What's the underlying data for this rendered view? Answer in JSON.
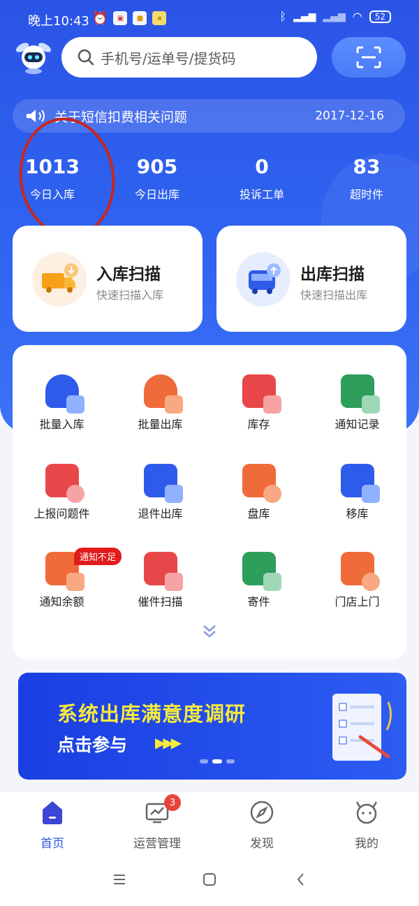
{
  "status": {
    "time": "晚上10:43",
    "battery": "52"
  },
  "search": {
    "placeholder": "手机号/运单号/提货码"
  },
  "notice": {
    "text": "关于短信扣费相关问题",
    "date": "2017-12-16"
  },
  "stats": [
    {
      "value": "1013",
      "label": "今日入库"
    },
    {
      "value": "905",
      "label": "今日出库"
    },
    {
      "value": "0",
      "label": "投诉工单"
    },
    {
      "value": "83",
      "label": "超时件"
    }
  ],
  "scan_cards": [
    {
      "title": "入库扫描",
      "subtitle": "快速扫描入库"
    },
    {
      "title": "出库扫描",
      "subtitle": "快速扫描出库"
    }
  ],
  "grid": [
    {
      "label": "批量入库",
      "icon": "cloud-in-icon",
      "color": "#2f5bea"
    },
    {
      "label": "批量出库",
      "icon": "cloud-out-icon",
      "color": "#ef6b3a"
    },
    {
      "label": "库存",
      "icon": "box-stack-icon",
      "color": "#e8474a"
    },
    {
      "label": "通知记录",
      "icon": "notice-record-icon",
      "color": "#2e9e5b"
    },
    {
      "label": "上报问题件",
      "icon": "problem-box-icon",
      "color": "#e8474a"
    },
    {
      "label": "退件出库",
      "icon": "return-icon",
      "color": "#2f5bea"
    },
    {
      "label": "盘库",
      "icon": "inventory-search-icon",
      "color": "#ef6b3a"
    },
    {
      "label": "移库",
      "icon": "move-cart-icon",
      "color": "#2f5bea"
    },
    {
      "label": "通知余额",
      "icon": "wallet-icon",
      "color": "#ef6b3a"
    },
    {
      "label": "催件扫描",
      "icon": "urge-scan-icon",
      "color": "#e8474a"
    },
    {
      "label": "寄件",
      "icon": "send-package-icon",
      "color": "#2e9e5b"
    },
    {
      "label": "门店上门",
      "icon": "store-visit-icon",
      "color": "#ef6b3a"
    }
  ],
  "notify_badge": "通知不足",
  "banner": {
    "title": "系统出库满意度调研",
    "subtitle": "点击参与"
  },
  "nav": [
    {
      "label": "首页",
      "icon": "home-icon"
    },
    {
      "label": "运营管理",
      "icon": "operations-icon",
      "badge": "3"
    },
    {
      "label": "发现",
      "icon": "compass-icon"
    },
    {
      "label": "我的",
      "icon": "profile-icon"
    }
  ]
}
